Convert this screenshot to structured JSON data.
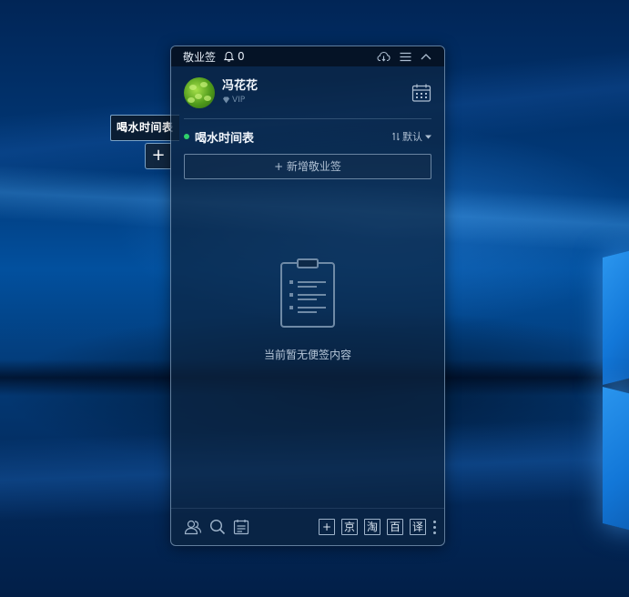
{
  "mini_note": {
    "title": "喝水时间表",
    "add_symbol": "+"
  },
  "widget": {
    "app_name": "敬业签",
    "notification_count": "0",
    "user": {
      "name": "冯花花",
      "badge": "VIP"
    },
    "list": {
      "title": "喝水时间表",
      "sort_label": "默认"
    },
    "add_button_label": "+ 新增敬业签",
    "empty_message": "当前暂无便签内容",
    "toolbar": {
      "add": "+",
      "jd": "京",
      "taobao": "淘",
      "baidu": "百",
      "translate": "译"
    }
  },
  "colors": {
    "status_dot": "#2fd06b",
    "accent_text": "#f0f5fb"
  },
  "icons": [
    "bell-icon",
    "cloud-sync-icon",
    "menu-icon",
    "collapse-icon",
    "calendar-icon",
    "sort-icon",
    "clipboard-icon",
    "contacts-icon",
    "search-icon",
    "notes-icon",
    "more-icon"
  ]
}
